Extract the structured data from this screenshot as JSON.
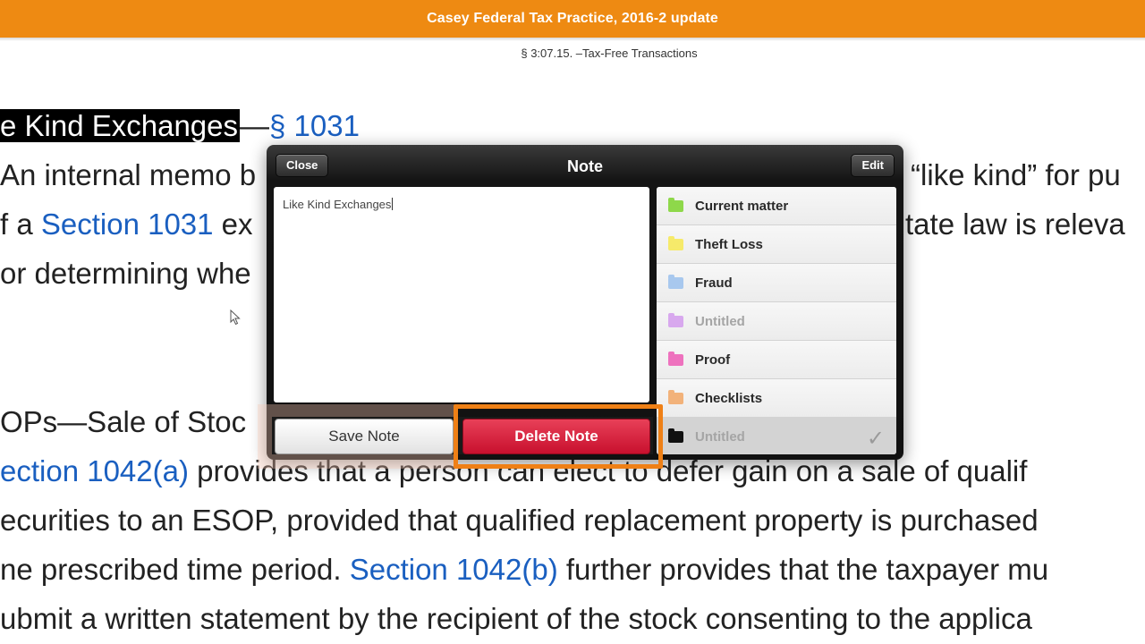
{
  "header": {
    "title": "Casey Federal Tax Practice, 2016-2 update",
    "section": "§ 3:07.15. –Tax-Free Transactions",
    "accent_color": "#ee8a12"
  },
  "document": {
    "heading_highlight": "e Kind Exchanges",
    "heading_dash": "—",
    "heading_link": "§ 1031",
    "p1_l1_a": "An internal memo b",
    "p1_l1_b": "“like kind” for pu",
    "p1_l2_a": "f a ",
    "p1_l2_link": "Section 1031",
    "p1_l2_b": " ex",
    "p1_l2_c": "tate law is releva",
    "p1_l3": "or determining whe",
    "esop_heading": "OPs—Sale of Stoc",
    "p2_l1_link": "ection 1042(a)",
    "p2_l1_rest": " provides that a person can elect to defer gain on a sale of qualif",
    "p2_l2": "ecurities to an ESOP, provided that qualified replacement property is purchased",
    "p2_l3_a": "ne prescribed time period. ",
    "p2_l3_link": "Section 1042(b)",
    "p2_l3_b": " further provides that the taxpayer mu",
    "p2_l4": "ubmit a written statement by the recipient of the stock consenting to the applica"
  },
  "note_popover": {
    "title": "Note",
    "close_label": "Close",
    "edit_label": "Edit",
    "note_text": "Like Kind Exchanges",
    "save_label": "Save Note",
    "delete_label": "Delete Note",
    "folders": [
      {
        "label": "Current matter",
        "color": "#8ed84a",
        "muted": false
      },
      {
        "label": "Theft Loss",
        "color": "#f6ea6a",
        "muted": false
      },
      {
        "label": "Fraud",
        "color": "#a8c8ee",
        "muted": false
      },
      {
        "label": "Untitled",
        "color": "#d8a8ee",
        "muted": true
      },
      {
        "label": "Proof",
        "color": "#ee72be",
        "muted": false
      },
      {
        "label": "Checklists",
        "color": "#f2b27a",
        "muted": false
      },
      {
        "label": "Untitled",
        "color": "#111111",
        "muted": true,
        "selected": true,
        "check": "✓"
      }
    ]
  }
}
